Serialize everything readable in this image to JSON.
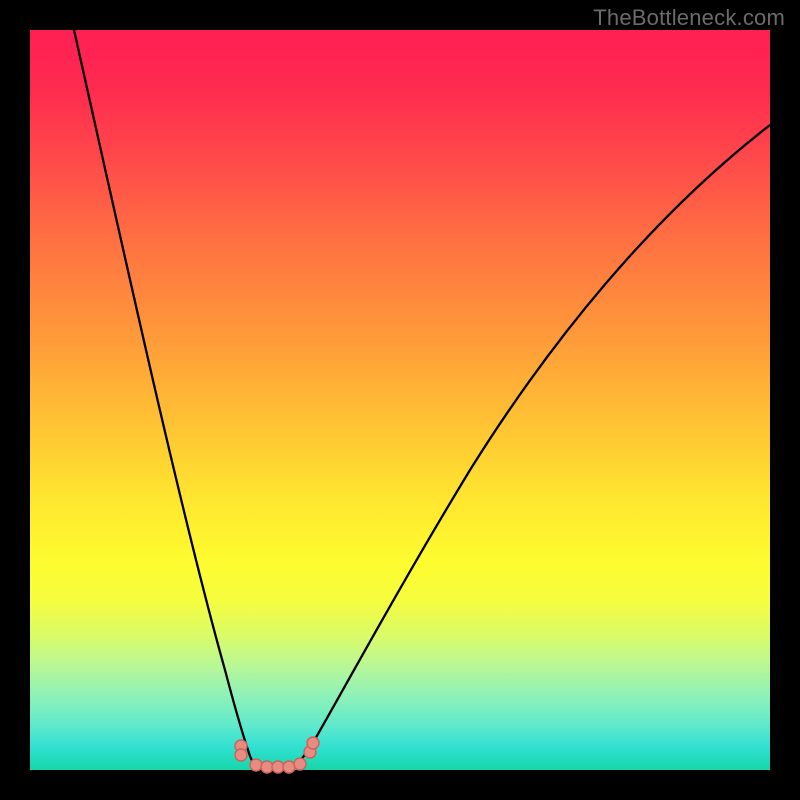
{
  "watermark": "TheBottleneck.com",
  "colors": {
    "gradient_top": "#ff1f54",
    "gradient_bottom": "#16d7a8",
    "curve": "#000000",
    "marker_fill": "#e88b83",
    "marker_stroke": "#cd6157",
    "frame_bg": "#000000"
  },
  "chart_data": {
    "type": "line",
    "title": "",
    "xlabel": "",
    "ylabel": "",
    "xlim": [
      0,
      100
    ],
    "ylim": [
      0,
      100
    ],
    "grid": false,
    "series": [
      {
        "name": "left-branch",
        "x": [
          6,
          10,
          14,
          18,
          22,
          25,
          27,
          29,
          30
        ],
        "values": [
          100,
          78,
          56,
          36,
          19,
          9,
          4,
          1,
          0
        ]
      },
      {
        "name": "right-branch",
        "x": [
          36,
          38,
          41,
          45,
          50,
          56,
          64,
          74,
          86,
          100
        ],
        "values": [
          0,
          2,
          6,
          12,
          20,
          30,
          42,
          56,
          72,
          87
        ]
      },
      {
        "name": "valley-floor",
        "x": [
          30,
          31,
          32,
          33,
          34,
          35,
          36
        ],
        "values": [
          0,
          0,
          0,
          0,
          0,
          0,
          0
        ]
      }
    ],
    "markers": {
      "name": "highlight-dots",
      "x": [
        28.5,
        28.5,
        30.5,
        32,
        33.5,
        35,
        36.5,
        37.8,
        38.2
      ],
      "values": [
        3.2,
        2.0,
        0.6,
        0.4,
        0.4,
        0.4,
        0.8,
        2.4,
        3.6
      ]
    }
  }
}
